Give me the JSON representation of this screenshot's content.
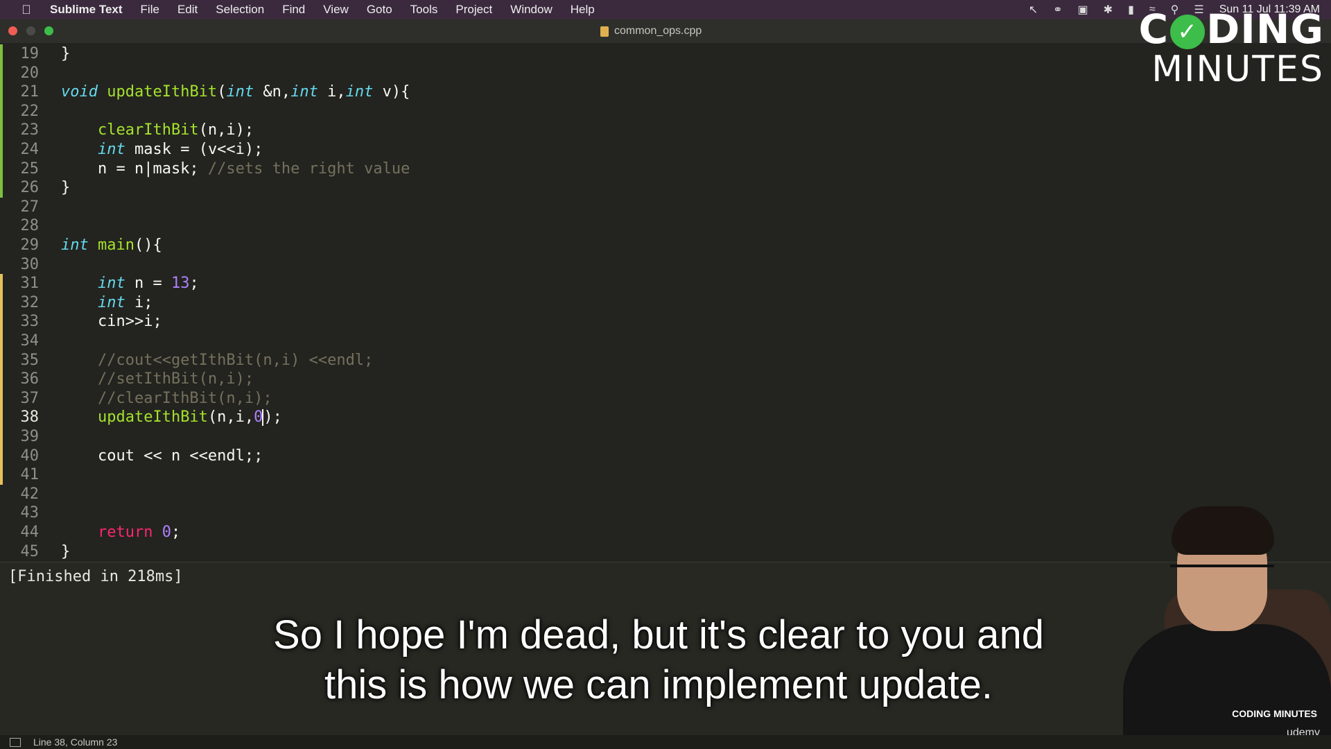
{
  "menubar": {
    "app_name": "Sublime Text",
    "items": [
      "File",
      "Edit",
      "Selection",
      "Find",
      "View",
      "Goto",
      "Tools",
      "Project",
      "Window",
      "Help"
    ],
    "datetime": "Sun 11 Jul 11:39 AM"
  },
  "window": {
    "tab_title": "common_ops.cpp"
  },
  "editor": {
    "lines": [
      {
        "n": "19",
        "mark": "green",
        "code": [
          [
            "t",
            "}"
          ]
        ]
      },
      {
        "n": "20",
        "mark": "green",
        "code": []
      },
      {
        "n": "21",
        "mark": "green",
        "code": [
          [
            "kw",
            "void"
          ],
          [
            "t",
            " "
          ],
          [
            "fn",
            "updateIthBit"
          ],
          [
            "t",
            "("
          ],
          [
            "kw",
            "int"
          ],
          [
            "t",
            " &n,"
          ],
          [
            "kw",
            "int"
          ],
          [
            "t",
            " i,"
          ],
          [
            "kw",
            "int"
          ],
          [
            "t",
            " v){"
          ]
        ]
      },
      {
        "n": "22",
        "mark": "green",
        "code": []
      },
      {
        "n": "23",
        "mark": "green",
        "code": [
          [
            "t",
            "    "
          ],
          [
            "fn",
            "clearIthBit"
          ],
          [
            "t",
            "(n,i);"
          ]
        ]
      },
      {
        "n": "24",
        "mark": "green",
        "code": [
          [
            "t",
            "    "
          ],
          [
            "kw",
            "int"
          ],
          [
            "t",
            " mask = (v<<i);"
          ]
        ]
      },
      {
        "n": "25",
        "mark": "green",
        "code": [
          [
            "t",
            "    n = n|mask; "
          ],
          [
            "cmt",
            "//sets the right value"
          ]
        ]
      },
      {
        "n": "26",
        "mark": "green",
        "code": [
          [
            "t",
            "}"
          ]
        ]
      },
      {
        "n": "27",
        "mark": "",
        "code": []
      },
      {
        "n": "28",
        "mark": "",
        "code": []
      },
      {
        "n": "29",
        "mark": "",
        "code": [
          [
            "kw",
            "int"
          ],
          [
            "t",
            " "
          ],
          [
            "fn",
            "main"
          ],
          [
            "t",
            "(){"
          ]
        ]
      },
      {
        "n": "30",
        "mark": "",
        "code": []
      },
      {
        "n": "31",
        "mark": "yellow",
        "code": [
          [
            "t",
            "    "
          ],
          [
            "kw",
            "int"
          ],
          [
            "t",
            " n = "
          ],
          [
            "num",
            "13"
          ],
          [
            "t",
            ";"
          ]
        ]
      },
      {
        "n": "32",
        "mark": "yellow",
        "code": [
          [
            "t",
            "    "
          ],
          [
            "kw",
            "int"
          ],
          [
            "t",
            " i;"
          ]
        ]
      },
      {
        "n": "33",
        "mark": "yellow",
        "code": [
          [
            "t",
            "    cin>>i;"
          ]
        ]
      },
      {
        "n": "34",
        "mark": "yellow",
        "code": []
      },
      {
        "n": "35",
        "mark": "yellow",
        "code": [
          [
            "t",
            "    "
          ],
          [
            "cmt",
            "//cout<<getIthBit(n,i) <<endl;"
          ]
        ]
      },
      {
        "n": "36",
        "mark": "yellow",
        "code": [
          [
            "t",
            "    "
          ],
          [
            "cmt",
            "//setIthBit(n,i);"
          ]
        ]
      },
      {
        "n": "37",
        "mark": "yellow",
        "code": [
          [
            "t",
            "    "
          ],
          [
            "cmt",
            "//clearIthBit(n,i);"
          ]
        ]
      },
      {
        "n": "38",
        "mark": "yellow",
        "current": true,
        "code": [
          [
            "t",
            "    "
          ],
          [
            "fn",
            "updateIthBit"
          ],
          [
            "t",
            "(n,i,"
          ],
          [
            "num",
            "0"
          ],
          [
            "cursor",
            ""
          ],
          [
            "t",
            ");"
          ]
        ]
      },
      {
        "n": "39",
        "mark": "yellow",
        "code": []
      },
      {
        "n": "40",
        "mark": "yellow",
        "code": [
          [
            "t",
            "    cout << n <<endl;;"
          ]
        ]
      },
      {
        "n": "41",
        "mark": "yellow",
        "code": []
      },
      {
        "n": "42",
        "mark": "",
        "code": []
      },
      {
        "n": "43",
        "mark": "",
        "code": []
      },
      {
        "n": "44",
        "mark": "",
        "code": [
          [
            "t",
            "    "
          ],
          [
            "ret",
            "return"
          ],
          [
            "t",
            " "
          ],
          [
            "num",
            "0"
          ],
          [
            "t",
            ";"
          ]
        ]
      },
      {
        "n": "45",
        "mark": "",
        "code": [
          [
            "t",
            "}"
          ]
        ]
      }
    ]
  },
  "output": {
    "text": "[Finished in 218ms]"
  },
  "subtitle": {
    "line1": "So I hope I'm dead, but it's clear to you and",
    "line2": "this is how we can implement update."
  },
  "statusbar": {
    "position": "Line 38, Column 23"
  },
  "branding": {
    "top_left": "C",
    "top_right": "DING",
    "bottom": "MINUTES",
    "small": "CODING MINUTES",
    "udemy": "udemy"
  },
  "colors": {
    "green_mark": "#7fbf3f",
    "yellow_mark": "#e6c15a",
    "keyword": "#66d9ef",
    "function": "#a6e22e",
    "number": "#ae81ff",
    "comment": "#75715e",
    "return": "#f92672"
  },
  "icons": {
    "menubar_status": [
      "arrow-icon",
      "creative-cloud-icon",
      "display-icon",
      "bluetooth-icon",
      "battery-icon",
      "wifi-icon",
      "search-icon",
      "control-center-icon"
    ]
  }
}
